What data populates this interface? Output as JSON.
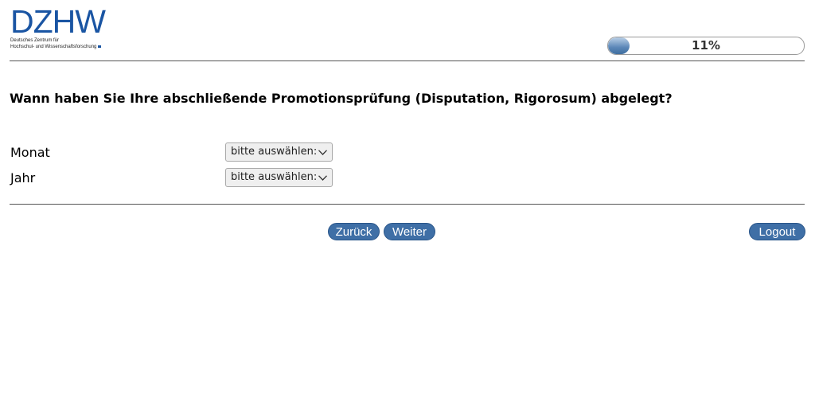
{
  "logo": {
    "wordmark": "DZHW",
    "subtitle_line1": "Deutsches Zentrum für",
    "subtitle_line2": "Hochschul- und Wissenschaftsforschung",
    "brand_color": "#1a55a3"
  },
  "progress": {
    "label": "11%",
    "value_percent": 11,
    "fill_color": "#4f7fb2"
  },
  "question": {
    "text": "Wann haben Sie Ihre abschließende Promotionsprüfung (Disputation, Rigorosum) abgelegt?"
  },
  "fields": [
    {
      "label": "Monat",
      "selected": "bitte auswählen:"
    },
    {
      "label": "Jahr",
      "selected": "bitte auswählen:"
    }
  ],
  "buttons": {
    "back": "Zurück",
    "next": "Weiter",
    "logout": "Logout",
    "color": "#3f6fa6"
  }
}
